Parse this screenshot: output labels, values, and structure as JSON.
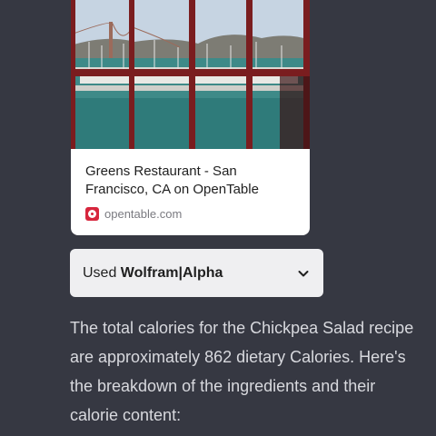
{
  "card": {
    "title": "Greens Restaurant - San Francisco, CA on OpenTable",
    "source_domain": "opentable.com",
    "source_icon": "opentable-logo-icon"
  },
  "tool": {
    "prefix": "Used ",
    "name": "Wolfram|Alpha",
    "expand_icon": "chevron-down-icon"
  },
  "answer": {
    "text": "The total calories for the Chickpea Salad recipe are approximately 862 dietary Calories. Here's the breakdown of the ingredients and their calorie content:"
  },
  "colors": {
    "background": "#363842",
    "card": "#ffffff",
    "pill": "#efeff1",
    "answer_text": "#d8d9de",
    "brand_red": "#d7263d"
  }
}
